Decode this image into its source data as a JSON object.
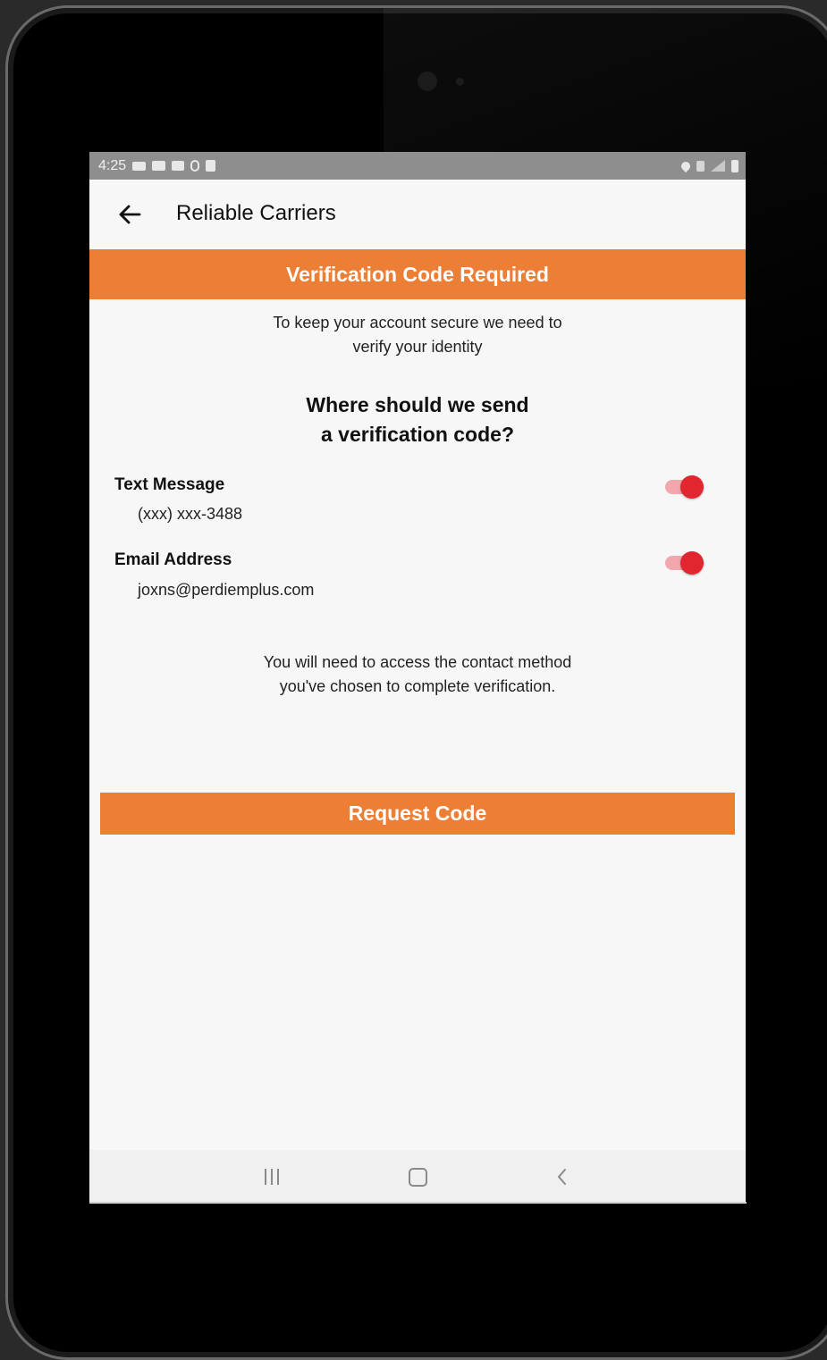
{
  "status_bar": {
    "time": "4:25"
  },
  "app_bar": {
    "title": "Reliable Carriers"
  },
  "banner": {
    "title": "Verification Code Required"
  },
  "intro": {
    "line1": "To keep your account secure we need to",
    "line2": "verify your identity"
  },
  "question": {
    "line1": "Where should we send",
    "line2": "a verification code?"
  },
  "options": [
    {
      "label": "Text Message",
      "value": "(xxx) xxx-3488",
      "enabled": true
    },
    {
      "label": "Email Address",
      "value": "joxns@perdiemplus.com",
      "enabled": true
    }
  ],
  "note": {
    "line1": "You will need to access the contact method",
    "line2": "you've chosen to complete verification."
  },
  "request_button": {
    "label": "Request Code"
  },
  "colors": {
    "accent": "#ec7f35",
    "toggle_on": "#e2262f",
    "status_bar": "#8e8e8e",
    "background": "#f7f7f7"
  }
}
